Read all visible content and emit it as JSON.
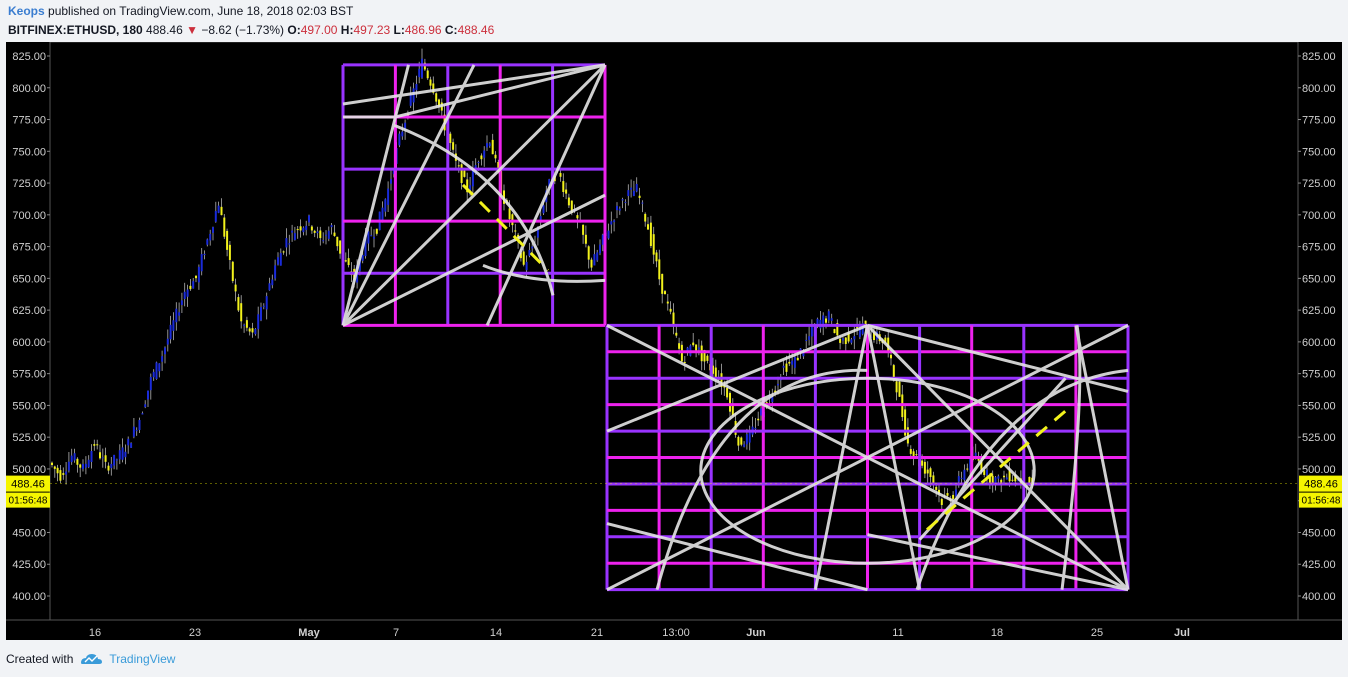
{
  "header": {
    "author": "Keops",
    "published": "published on TradingView.com, June 18, 2018 02:03 BST",
    "symbol": "BITFINEX:ETHUSD, 180",
    "last": "488.46",
    "change": "−8.62 (−1.73%)",
    "o_label": "O:",
    "o": "497.00",
    "h_label": "H:",
    "h": "497.23",
    "l_label": "L:",
    "l": "486.96",
    "c_label": "C:",
    "c": "488.46"
  },
  "footer": {
    "created": "Created with",
    "brand": "TradingView"
  },
  "colors": {
    "background": "#000000",
    "up_bar": "#1a2bd9",
    "down_bar": "#f2f21c",
    "box_violet": "#9933ff",
    "box_magenta": "#ee22ee",
    "fan_lines": "#e6e6e6",
    "price_tag": "#f5f500"
  },
  "chart_data": {
    "type": "candlestick",
    "symbol": "BITFINEX:ETHUSD",
    "interval": "180",
    "y_ticks": [
      "825.00",
      "800.00",
      "775.00",
      "750.00",
      "725.00",
      "700.00",
      "675.00",
      "650.00",
      "625.00",
      "600.00",
      "575.00",
      "550.00",
      "525.00",
      "500.00",
      "475.00",
      "450.00",
      "425.00",
      "400.00"
    ],
    "ylim": [
      400,
      825
    ],
    "x_ticks": [
      "16",
      "23",
      "May",
      "7",
      "14",
      "21",
      "13:00",
      "Jun",
      "11",
      "18",
      "25",
      "Jul"
    ],
    "last_price": "488.46",
    "countdown": "01:56:48",
    "price_path": [
      [
        0,
        505
      ],
      [
        1,
        495
      ],
      [
        2,
        510
      ],
      [
        3,
        500
      ],
      [
        4,
        520
      ],
      [
        5,
        502
      ],
      [
        6,
        508
      ],
      [
        7,
        520
      ],
      [
        8,
        540
      ],
      [
        9,
        570
      ],
      [
        10,
        590
      ],
      [
        11,
        615
      ],
      [
        12,
        640
      ],
      [
        13,
        650
      ],
      [
        14,
        680
      ],
      [
        15,
        710
      ],
      [
        16,
        660
      ],
      [
        17,
        615
      ],
      [
        18,
        605
      ],
      [
        19,
        630
      ],
      [
        20,
        660
      ],
      [
        21,
        680
      ],
      [
        22,
        690
      ],
      [
        23,
        695
      ],
      [
        24,
        680
      ],
      [
        25,
        690
      ],
      [
        26,
        665
      ],
      [
        27,
        650
      ],
      [
        28,
        680
      ],
      [
        29,
        690
      ],
      [
        30,
        720
      ],
      [
        31,
        760
      ],
      [
        32,
        790
      ],
      [
        33,
        820
      ],
      [
        34,
        800
      ],
      [
        35,
        770
      ],
      [
        36,
        740
      ],
      [
        37,
        720
      ],
      [
        38,
        745
      ],
      [
        39,
        760
      ],
      [
        40,
        720
      ],
      [
        41,
        690
      ],
      [
        42,
        660
      ],
      [
        43,
        680
      ],
      [
        44,
        720
      ],
      [
        45,
        735
      ],
      [
        46,
        710
      ],
      [
        47,
        690
      ],
      [
        48,
        660
      ],
      [
        49,
        680
      ],
      [
        50,
        700
      ],
      [
        51,
        715
      ],
      [
        52,
        720
      ],
      [
        53,
        690
      ],
      [
        54,
        650
      ],
      [
        55,
        620
      ],
      [
        56,
        585
      ],
      [
        57,
        600
      ],
      [
        58,
        585
      ],
      [
        59,
        575
      ],
      [
        60,
        560
      ],
      [
        61,
        520
      ],
      [
        62,
        525
      ],
      [
        63,
        545
      ],
      [
        64,
        560
      ],
      [
        65,
        580
      ],
      [
        66,
        585
      ],
      [
        67,
        600
      ],
      [
        68,
        615
      ],
      [
        69,
        620
      ],
      [
        70,
        600
      ],
      [
        71,
        605
      ],
      [
        72,
        612
      ],
      [
        73,
        605
      ],
      [
        74,
        600
      ],
      [
        75,
        565
      ],
      [
        76,
        520
      ],
      [
        77,
        505
      ],
      [
        78,
        495
      ],
      [
        79,
        475
      ],
      [
        80,
        480
      ],
      [
        81,
        500
      ],
      [
        82,
        510
      ],
      [
        83,
        495
      ],
      [
        84,
        490
      ],
      [
        85,
        495
      ],
      [
        86,
        490
      ],
      [
        87,
        488
      ]
    ],
    "overlays": [
      {
        "name": "upper-square",
        "x_range": [
          "May 3",
          "May 22"
        ],
        "y_range": [
          613,
          818
        ],
        "divisions": 5
      },
      {
        "name": "lower-square",
        "x_range": [
          "May 22",
          "Jun 26"
        ],
        "y_range": [
          405,
          613
        ],
        "divisions": 10
      }
    ]
  }
}
